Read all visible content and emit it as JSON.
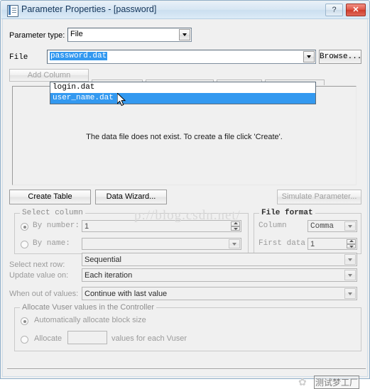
{
  "window": {
    "title": "Parameter Properties - [password]",
    "icon": "parameter-file-icon",
    "help_label": "?",
    "close_label": "✕",
    "accent_title": "#15365a",
    "close_color": "#cf3c2c",
    "selection_color": "#3399f0"
  },
  "parameter_type": {
    "label": "Parameter type:",
    "value": "File"
  },
  "file_row": {
    "label": "File",
    "value": "password.dat",
    "browse_label": "Browse...",
    "dropdown_open": true,
    "options": [
      {
        "label": "login.dat",
        "selected": false
      },
      {
        "label": "user_name.dat",
        "selected": true
      }
    ]
  },
  "add_column": {
    "label": "Add Column"
  },
  "data_panel": {
    "message": "The data file does not exist. To create a file click 'Create'."
  },
  "action_buttons": [
    {
      "name": "create-table-button",
      "label": "Create Table",
      "disabled": false
    },
    {
      "name": "data-wizard-button",
      "label": "Data Wizard...",
      "disabled": false
    },
    {
      "name": "simulate-parameter-button",
      "label": "Simulate Parameter...",
      "disabled": true
    }
  ],
  "select_column": {
    "legend": "Select column",
    "by_number": {
      "label": "By number:",
      "value": "1",
      "checked": true
    },
    "by_name": {
      "label": "By name:",
      "value": "",
      "checked": false
    }
  },
  "file_format": {
    "legend": "File format",
    "column": {
      "label": "Column",
      "value": "Comma"
    },
    "first_data": {
      "label": "First data",
      "value": "1"
    }
  },
  "rows": {
    "select_next_row": {
      "label": "Select next row:",
      "value": "Sequential"
    },
    "update_value_on": {
      "label": "Update value on:",
      "value": "Each iteration"
    },
    "when_out_of_values": {
      "label": "When out of values:",
      "value": "Continue with last value"
    }
  },
  "allocate": {
    "legend": "Allocate Vuser values in the Controller",
    "auto": {
      "label": "Automatically allocate block size",
      "checked": true
    },
    "manual": {
      "label": "Allocate",
      "value": "",
      "suffix": "values for each Vuser",
      "checked": false
    }
  },
  "watermarks": {
    "csdn": "p://blog.csdn.net/",
    "wechat_logo": "✿",
    "wechat_text": "测试梦工厂"
  }
}
